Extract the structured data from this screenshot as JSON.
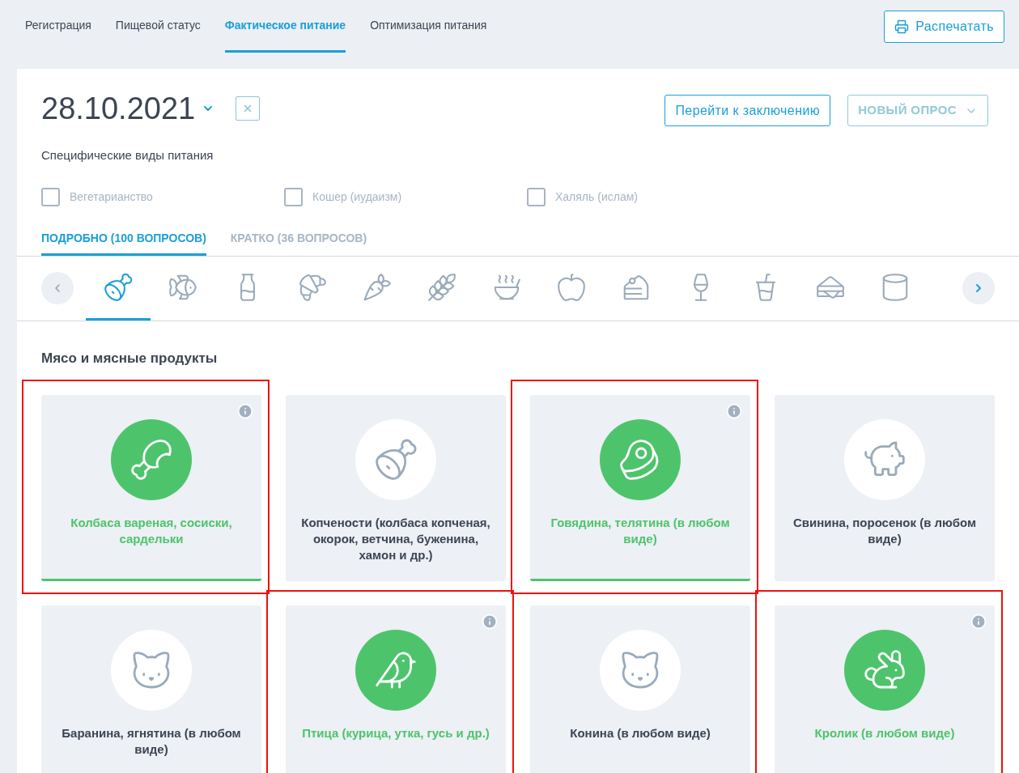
{
  "nav_tabs": [
    {
      "label": "Регистрация",
      "selected": false
    },
    {
      "label": "Пищевой статус",
      "selected": false
    },
    {
      "label": "Фактическое питание",
      "selected": true
    },
    {
      "label": "Оптимизация питания",
      "selected": false
    }
  ],
  "print_button": "Распечатать",
  "date": "28.10.2021",
  "conclusion_button": "Перейти к заключению",
  "new_survey_button": "НОВЫЙ ОПРОС",
  "diet_heading": "Специфические виды питания",
  "diets": [
    {
      "label": "Вегетарианство",
      "checked": false
    },
    {
      "label": "Кошер (иудаизм)",
      "checked": false
    },
    {
      "label": "Халяль (ислам)",
      "checked": false
    }
  ],
  "mode_tabs": [
    {
      "label": "ПОДРОБНО (100 ВОПРОСОВ)",
      "selected": true
    },
    {
      "label": "КРАТКО (36 ВОПРОСОВ)",
      "selected": false
    }
  ],
  "categories": [
    {
      "selected": true
    },
    {
      "selected": false
    },
    {
      "selected": false
    },
    {
      "selected": false
    },
    {
      "selected": false
    },
    {
      "selected": false
    },
    {
      "selected": false
    },
    {
      "selected": false
    },
    {
      "selected": false
    },
    {
      "selected": false
    },
    {
      "selected": false
    },
    {
      "selected": false
    },
    {
      "selected": false
    }
  ],
  "section_title": "Мясо и мясные продукты",
  "foods": [
    {
      "label": "Колбаса вареная, сосиски, сардельки",
      "selected": true
    },
    {
      "label": "Копчености (колбаса копченая, окорок, ветчина, буженина, хамон и др.)",
      "selected": false
    },
    {
      "label": "Говядина, телятина (в любом виде)",
      "selected": true
    },
    {
      "label": "Свинина, поросенок (в любом виде)",
      "selected": false
    },
    {
      "label": "Баранина, ягнятина (в любом виде)",
      "selected": false
    },
    {
      "label": "Птица (курица, утка, гусь и др.)",
      "selected": true
    },
    {
      "label": "Конина (в любом виде)",
      "selected": false
    },
    {
      "label": "Кролик (в любом виде)",
      "selected": true
    }
  ]
}
